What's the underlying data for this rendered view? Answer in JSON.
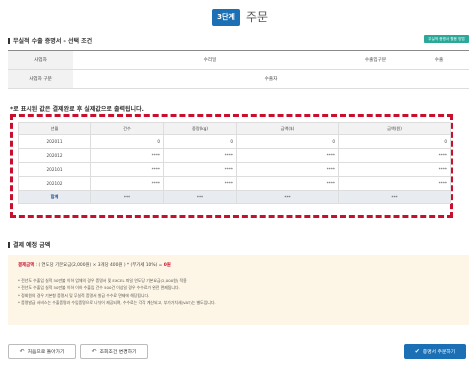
{
  "header": {
    "step_badge": "3단계",
    "step_title": "주문"
  },
  "conditions": {
    "title": "무실적 수출 증명서 - 선택 조건",
    "guide_button": "무실적 증명서 활용 방법",
    "row1": [
      {
        "label": "사업자",
        "value": ""
      },
      {
        "label": "수리일",
        "value": ""
      },
      {
        "label": "수출입구분",
        "value": "수출"
      }
    ],
    "row2": [
      {
        "label": "사업자 구분",
        "value": "수출자"
      }
    ]
  },
  "result_notice": "*로 표시된 값은 결제완료 후 실제값으로 출력됩니다.",
  "data_table": {
    "headers": [
      "년월",
      "건수",
      "중량(kg)",
      "금액($)",
      "금액(원)"
    ],
    "rows": [
      [
        "202011",
        "0",
        "0",
        "0",
        "0"
      ],
      [
        "202012",
        "****",
        "****",
        "****",
        "****"
      ],
      [
        "202101",
        "****",
        "****",
        "****",
        "****"
      ],
      [
        "202102",
        "****",
        "****",
        "****",
        "****"
      ]
    ],
    "total": [
      "합계",
      "***",
      "***",
      "***",
      "***"
    ]
  },
  "payment": {
    "title": "결제 예정 금액",
    "formula_label": "결제금액",
    "formula_text": ": ( 연도당 기본요금(2,000원) × 3개당 400원 ) * (부가세 10%) =",
    "formula_amount": "0원",
    "bullets": [
      "* 전년도 수출입 실적 50만불 이하 업체의 경우 증명서 및 EXCEL 파일 연도당 기본요금(2,000원) 적용",
      "* 전년도 수출입 실적 50만불 이하 이하 수출입 건수 500건 이상일 경우 수수료가 완전 면제됩니다.",
      "* 정회원의 경우 기본형 증명서 및 무실적 증명서 발급 수수료 면제에 해당됩니다.",
      "* 증명발급 서비스는 수출증명과 수입증명으로 나뉘어 제공되며, 수수료는 각각 계산되고, 부가가치세(VAT)는 별도입니다."
    ]
  },
  "buttons": {
    "back_first": "처음으로 돌아가기",
    "change_condition": "조회조건 변경하기",
    "order": "증명서 주문하기"
  },
  "colors": {
    "accent": "#1a6fb5",
    "guide": "#2aa89a",
    "dashed_border": "#c8102e",
    "payment_bg": "#fdf6e6"
  }
}
